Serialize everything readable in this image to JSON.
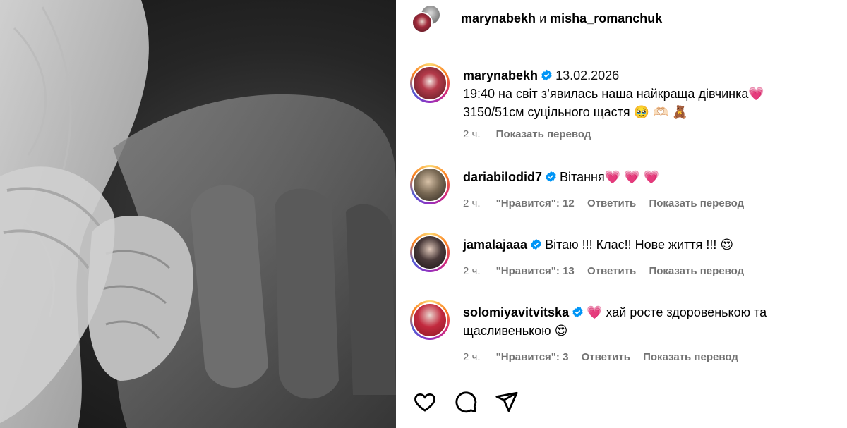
{
  "header": {
    "user1": "marynabekh",
    "conjunction": "и",
    "user2": "misha_romanchuk"
  },
  "caption": {
    "username": "marynabekh",
    "date": "13.02.2026",
    "line1": "19:40 на світ з’явилась наша найкраща дівчинка💗",
    "line2": "3150/51см суцільного щастя 🥹 🫶🏻 🧸",
    "time": "2 ч.",
    "translate": "Показать перевод"
  },
  "comments": [
    {
      "username": "dariabilodid7",
      "text": "Вітання💗 💗 💗",
      "time": "2 ч.",
      "likes": "\"Нравится\": 12",
      "reply": "Ответить",
      "translate": "Показать перевод"
    },
    {
      "username": "jamalajaaa",
      "text": "Вітаю !!! Клас!! Нове життя !!! 😍",
      "time": "2 ч.",
      "likes": "\"Нравится\": 13",
      "reply": "Ответить",
      "translate": "Показать перевод"
    },
    {
      "username": "solomiyavitvitska",
      "text": "💗 хай росте здоровенькою та",
      "text2": "щасливенькою 😍",
      "time": "2 ч.",
      "likes": "\"Нравится\": 3",
      "reply": "Ответить",
      "translate": "Показать перевод"
    }
  ],
  "icons": {
    "like": "heart-outline-icon",
    "comment": "comment-bubble-icon",
    "share": "paper-plane-icon",
    "verified": "verified-badge-icon"
  },
  "colors": {
    "verified": "#0095f6",
    "meta": "#737373"
  }
}
